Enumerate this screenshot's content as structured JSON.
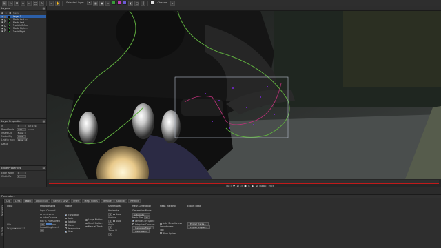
{
  "toolbar": {
    "tool_icons": [
      "pointer-icon",
      "bspline-icon",
      "xspline-icon",
      "magnetic-icon",
      "rect-icon",
      "ellipse-icon",
      "freehand-icon"
    ],
    "mode_label": "Selected layer",
    "mode_value": "▾",
    "channel_label": "Channel",
    "swatches": [
      "#3a9c3a",
      "#c23bb8",
      "#6b5bd6",
      "#e0e0e0"
    ]
  },
  "layers": {
    "title": "Layers",
    "columns": [
      "●",
      "☐",
      "■",
      "Name"
    ],
    "items": [
      {
        "name": "Layer 1",
        "color": "#3ab83a",
        "selected": true
      },
      {
        "name": "Matte Left L...",
        "color": "#2fa02f",
        "selected": false
      },
      {
        "name": "Matte Left L...",
        "color": "#2fa02f",
        "selected": false
      },
      {
        "name": "Track left Arm",
        "color": "#2fa02f",
        "selected": false
      },
      {
        "name": "Matte Right...",
        "color": "#2fa02f",
        "selected": false
      },
      {
        "name": "Track Right...",
        "color": "#2fa02f",
        "selected": false
      }
    ]
  },
  "layer_properties": {
    "title": "Layer Properties",
    "rows": [
      {
        "label": "In",
        "value": "1",
        "extra": "Out  1194"
      },
      {
        "label": "Blend Mode",
        "value": "Add",
        "extra": "Invert"
      },
      {
        "label": "Insert Clip",
        "value": "None",
        "extra": ""
      },
      {
        "label": "Matte Clip",
        "value": "None",
        "extra": ""
      },
      {
        "label": "Link to track",
        "value": "Layer 12",
        "extra": ""
      },
      {
        "label": "Detail",
        "value": "",
        "extra": ""
      }
    ]
  },
  "edge_properties": {
    "title": "Edge Properties",
    "rows": [
      {
        "label": "Edge Width",
        "value": "0"
      },
      {
        "label": "Width Ro",
        "value": "0"
      }
    ]
  },
  "timeline": {
    "frame_start": "1",
    "frame_end": "1194",
    "track_label": "Track",
    "controls": [
      "⏮",
      "◀",
      "◁",
      "■",
      "▷",
      "▶",
      "⏭"
    ],
    "progress": 1.0
  },
  "parameters": {
    "title": "Parameters",
    "side_tabs": [
      "Parameters",
      "Clip Tools"
    ],
    "tabs": [
      "Clip",
      "Lens",
      "Track",
      "AdjustTrack",
      "Camera Solve",
      "Insert",
      "Mega Plates",
      "Remove",
      "Stabilize",
      "Restrict"
    ],
    "active_tab": "Track",
    "input": {
      "heading": "Input",
      "clip_label": "Clip",
      "clip_value": "Layer Below"
    },
    "preprocessing": {
      "heading": "Preprocessing",
      "input_channel": "Input Channel",
      "luminance": "Luminance",
      "auto_channel": "Auto Channel",
      "min_pixels": "Min % Pixels Used",
      "min_pixels_value": "70",
      "smoothing": "Smoothing Level",
      "smoothing_value": "0"
    },
    "motion": {
      "heading": "Motion",
      "translation": "Translation",
      "scale": "Scale",
      "rotation": "Rotation",
      "shear": "Shear",
      "perspective": "Perspective",
      "mesh": "Mesh",
      "large": "Large Motion",
      "small": "Small Motion",
      "manual": "Manual Track"
    },
    "search_area": {
      "heading": "Search Area",
      "horizontal": "Horizontal",
      "horizontal_value": "0",
      "auto": "Auto",
      "vertical": "Vertical",
      "vertical_value": "0",
      "angle": "Angle",
      "angle_value": "0",
      "zoom": "Zoom %",
      "zoom_value": "0"
    },
    "mesh_generation": {
      "heading": "Mesh Generation",
      "gen_mode": "Generation Mode",
      "gen_mode_value": "Automatic",
      "mesh_size": "Mesh Size",
      "mesh_size_value": "25",
      "vertices": "Vertices on Spline",
      "adaptive": "Adaptive Contrast",
      "generate_btn": "Generate Mesh",
      "clear_btn": "Clear Mesh"
    },
    "mesh_tracking": {
      "heading": "Mesh Tracking",
      "auto_smooth": "Auto Smoothness",
      "smoothness": "Smoothness",
      "smoothness_value": "0",
      "warp_spline": "Warp Spline"
    },
    "export": {
      "heading": "Export Data",
      "export_tracks": "Export Tracks...",
      "export_shapes": "Export Shapes..."
    }
  },
  "colors": {
    "spline": "#5fae3f",
    "mesh_box": "#b9c2d0",
    "mesh_point": "#7a2ad8",
    "timeline_red": "#c01a1a",
    "selection_blue": "#2c5fa8"
  }
}
